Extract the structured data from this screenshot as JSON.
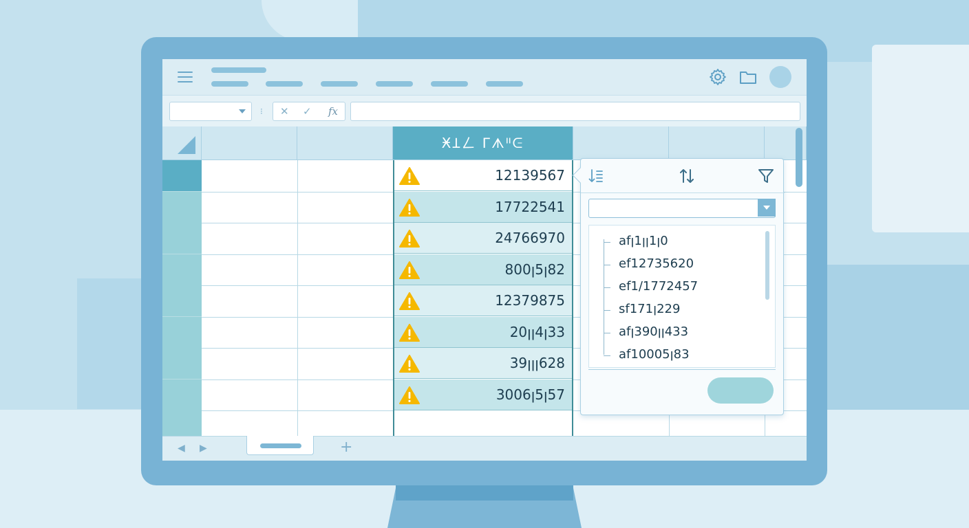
{
  "grid": {
    "selected_column_header": "ӾꞱㄥ ᒥᗑᐦᕮ",
    "selected_cells": [
      {
        "value": "12139567",
        "warning": true
      },
      {
        "value": "17722541",
        "warning": true
      },
      {
        "value": "24766970",
        "warning": true
      },
      {
        "value": "800ꞁ5ꞁ82",
        "warning": true
      },
      {
        "value": "12379875",
        "warning": true
      },
      {
        "value": "20ꞁꞁ4ꞁ33",
        "warning": true
      },
      {
        "value": "39ꞁꞁꞁ628",
        "warning": true
      },
      {
        "value": "3006ꞁ5ꞁ57",
        "warning": true
      }
    ]
  },
  "filter_popup": {
    "tools": [
      "sort-descending-icon",
      "sort-icon",
      "filter-icon"
    ],
    "search_value": "",
    "items": [
      "afꞁ1ꞁꞁ1ꞁ0",
      "ef12735620",
      "ef1/1772457",
      "sf171ꞁ229",
      "afꞁ390ꞁꞁ433",
      "af10005ꞁ83"
    ],
    "ok_label": ""
  },
  "colors": {
    "accent": "#5aaec5",
    "warning": "#f5b800",
    "bezel": "#78b3d5"
  }
}
